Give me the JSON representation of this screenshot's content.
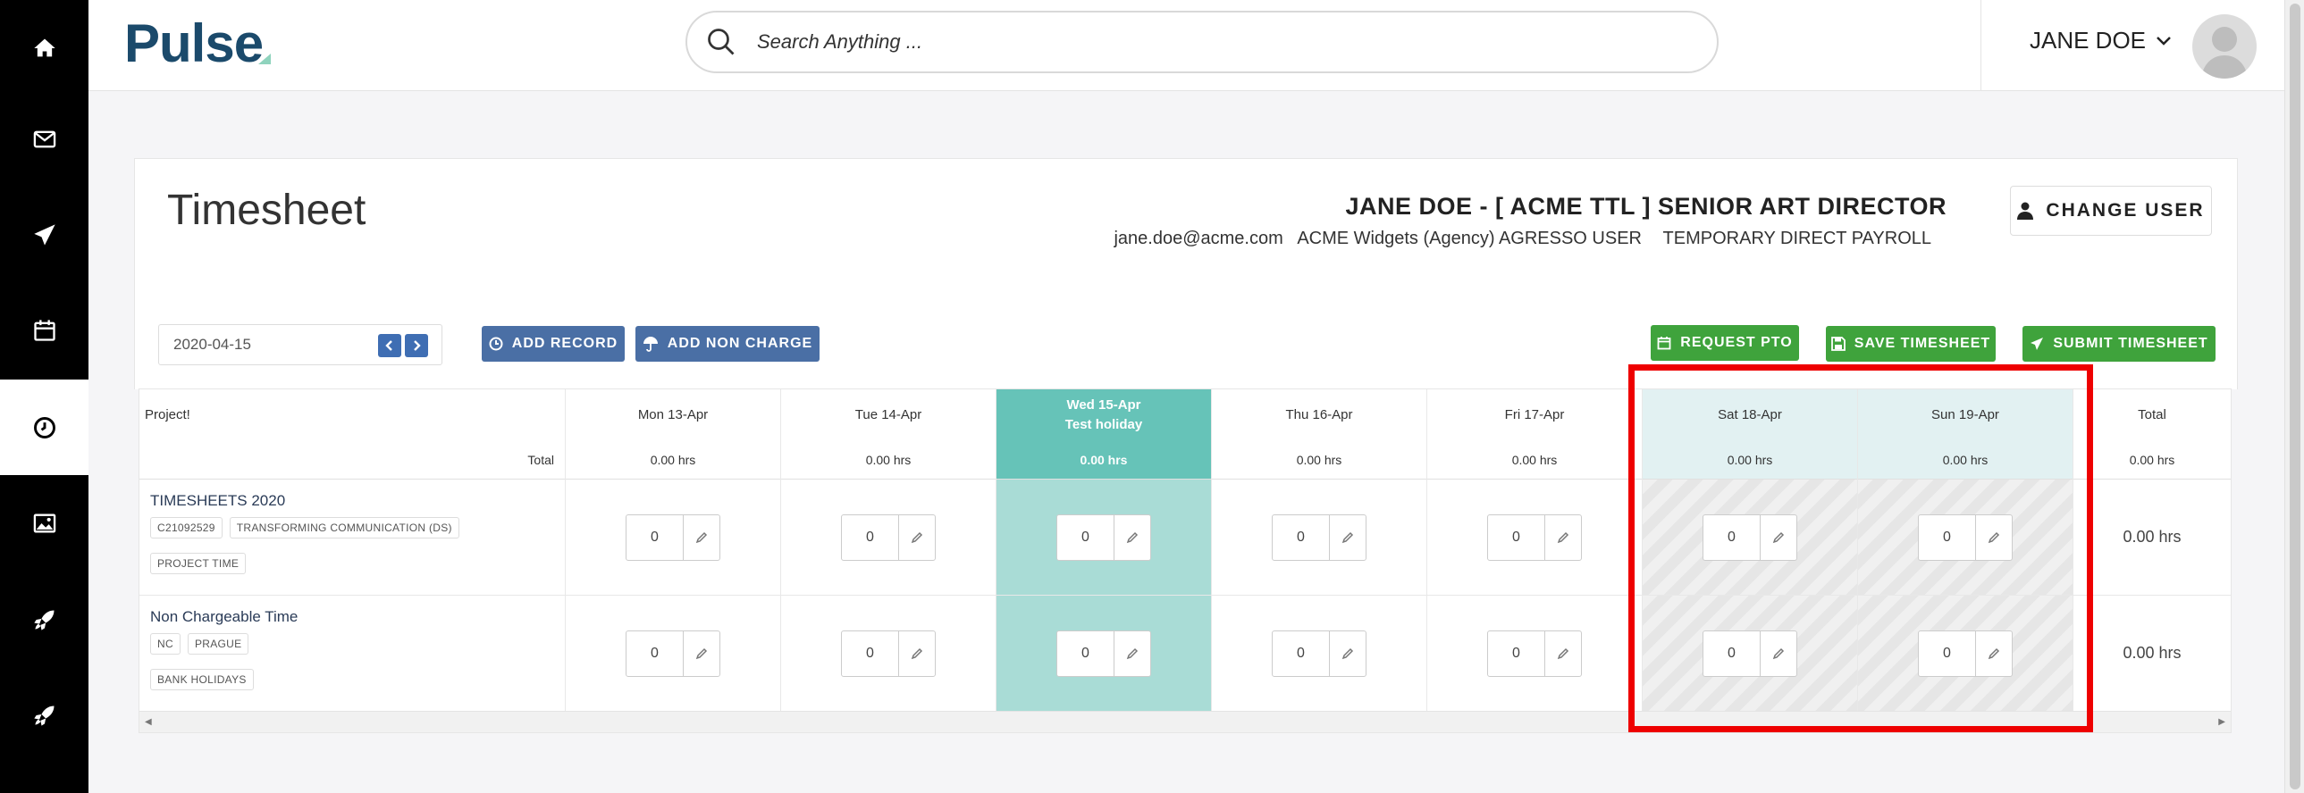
{
  "app": {
    "logo": "Pulse"
  },
  "rail": {
    "items": [
      {
        "name": "home-icon"
      },
      {
        "name": "mail-icon"
      },
      {
        "name": "send-icon"
      },
      {
        "name": "calendar-icon"
      },
      {
        "name": "clock-icon",
        "active": true
      },
      {
        "name": "image-icon"
      },
      {
        "name": "rocket-icon"
      },
      {
        "name": "rocket-icon-2"
      }
    ]
  },
  "header": {
    "search_placeholder": "Search Anything ...",
    "user_name": "JANE DOE"
  },
  "page": {
    "title": "Timesheet",
    "employee_name": "JANE DOE - [ ACME TTL ] SENIOR ART DIRECTOR",
    "employee_email": "jane.doe@acme.com",
    "employee_company": "ACME Widgets (Agency) AGRESSO USER",
    "employee_payroll": "TEMPORARY DIRECT PAYROLL",
    "change_user_label": "CHANGE USER"
  },
  "toolbar": {
    "date": "2020-04-15",
    "add_record": "ADD RECORD",
    "add_non_charge": "ADD NON CHARGE",
    "request_pto": "REQUEST PTO",
    "save_timesheet": "SAVE TIMESHEET",
    "submit_timesheet": "SUBMIT TIMESHEET"
  },
  "grid": {
    "project_header": "Project!",
    "total_label": "Total",
    "total_header": "Total",
    "days": [
      {
        "label": "Mon 13-Apr",
        "total": "0.00 hrs"
      },
      {
        "label": "Tue 14-Apr",
        "total": "0.00 hrs"
      },
      {
        "label": "Wed 15-Apr",
        "sub": "Test holiday",
        "total": "0.00 hrs"
      },
      {
        "label": "Thu 16-Apr",
        "total": "0.00 hrs"
      },
      {
        "label": "Fri 17-Apr",
        "total": "0.00 hrs"
      },
      {
        "label": "Sat 18-Apr",
        "total": "0.00 hrs"
      },
      {
        "label": "Sun 19-Apr",
        "total": "0.00 hrs"
      }
    ],
    "grand_total": "0.00 hrs",
    "rows": [
      {
        "name": "TIMESHEETS 2020",
        "tag1": "C21092529",
        "tag2": "TRANSFORMING COMMUNICATION (DS)",
        "tag3": "PROJECT TIME",
        "values": [
          "0",
          "0",
          "0",
          "0",
          "0",
          "0",
          "0"
        ],
        "total": "0.00 hrs"
      },
      {
        "name": "Non Chargeable Time",
        "tag1": "NC",
        "tag2": "PRAGUE",
        "tag3": "BANK HOLIDAYS",
        "values": [
          "0",
          "0",
          "0",
          "0",
          "0",
          "0",
          "0"
        ],
        "total": "0.00 hrs"
      }
    ]
  },
  "colors": {
    "rail": "#000000",
    "holiday": "#66c3b8",
    "weekend": "#e2f1f2",
    "blue_button": "#4a6fa5",
    "green_button": "#3fa33c",
    "highlight": "#ee0000"
  }
}
